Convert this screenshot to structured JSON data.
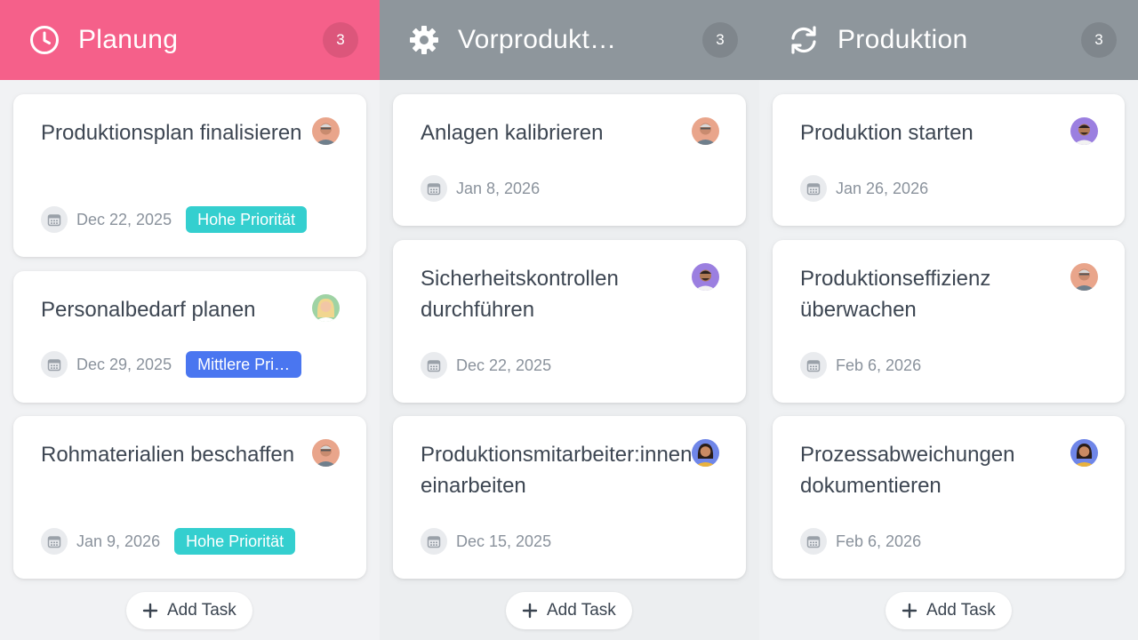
{
  "colors": {
    "planung_header": "#f5608a",
    "neutral_header": "#8e969c",
    "high_priority": "#34cfcf",
    "medium_priority": "#4a76f0"
  },
  "columns": [
    {
      "title": "Planung",
      "icon": "clock-icon",
      "count": "3",
      "add_label": "Add Task",
      "cards": [
        {
          "title": "Produktionsplan finalisieren",
          "date": "Dec 22, 2025",
          "badge": "Hohe Priorität",
          "avatar": "avatar-older-man"
        },
        {
          "title": "Personalbedarf planen",
          "date": "Dec 29, 2025",
          "badge": "Mittlere Pri…",
          "avatar": "avatar-blonde-woman"
        },
        {
          "title": "Rohmaterialien beschaffen",
          "date": "Jan 9, 2026",
          "badge": "Hohe Priorität",
          "avatar": "avatar-older-man"
        }
      ]
    },
    {
      "title": "Vorprodukt…",
      "icon": "gear-icon",
      "count": "3",
      "add_label": "Add Task",
      "cards": [
        {
          "title": "Anlagen kalibrieren",
          "date": "Jan 8, 2026",
          "avatar": "avatar-older-man"
        },
        {
          "title": "Sicherheitskontrollen durchführen",
          "date": "Dec 22, 2025",
          "avatar": "avatar-young-man"
        },
        {
          "title": "Produktionsmitarbeiter:innen einarbeiten",
          "date": "Dec 15, 2025",
          "avatar": "avatar-dark-hair-woman"
        }
      ]
    },
    {
      "title": "Produktion",
      "icon": "refresh-icon",
      "count": "3",
      "add_label": "Add Task",
      "cards": [
        {
          "title": "Produktion starten",
          "date": "Jan 26, 2026",
          "avatar": "avatar-young-man"
        },
        {
          "title": "Produktionseffizienz überwachen",
          "date": "Feb 6, 2026",
          "avatar": "avatar-older-man"
        },
        {
          "title": "Prozessabweichungen dokumentieren",
          "date": "Feb 6, 2026",
          "avatar": "avatar-dark-hair-woman"
        }
      ]
    }
  ]
}
